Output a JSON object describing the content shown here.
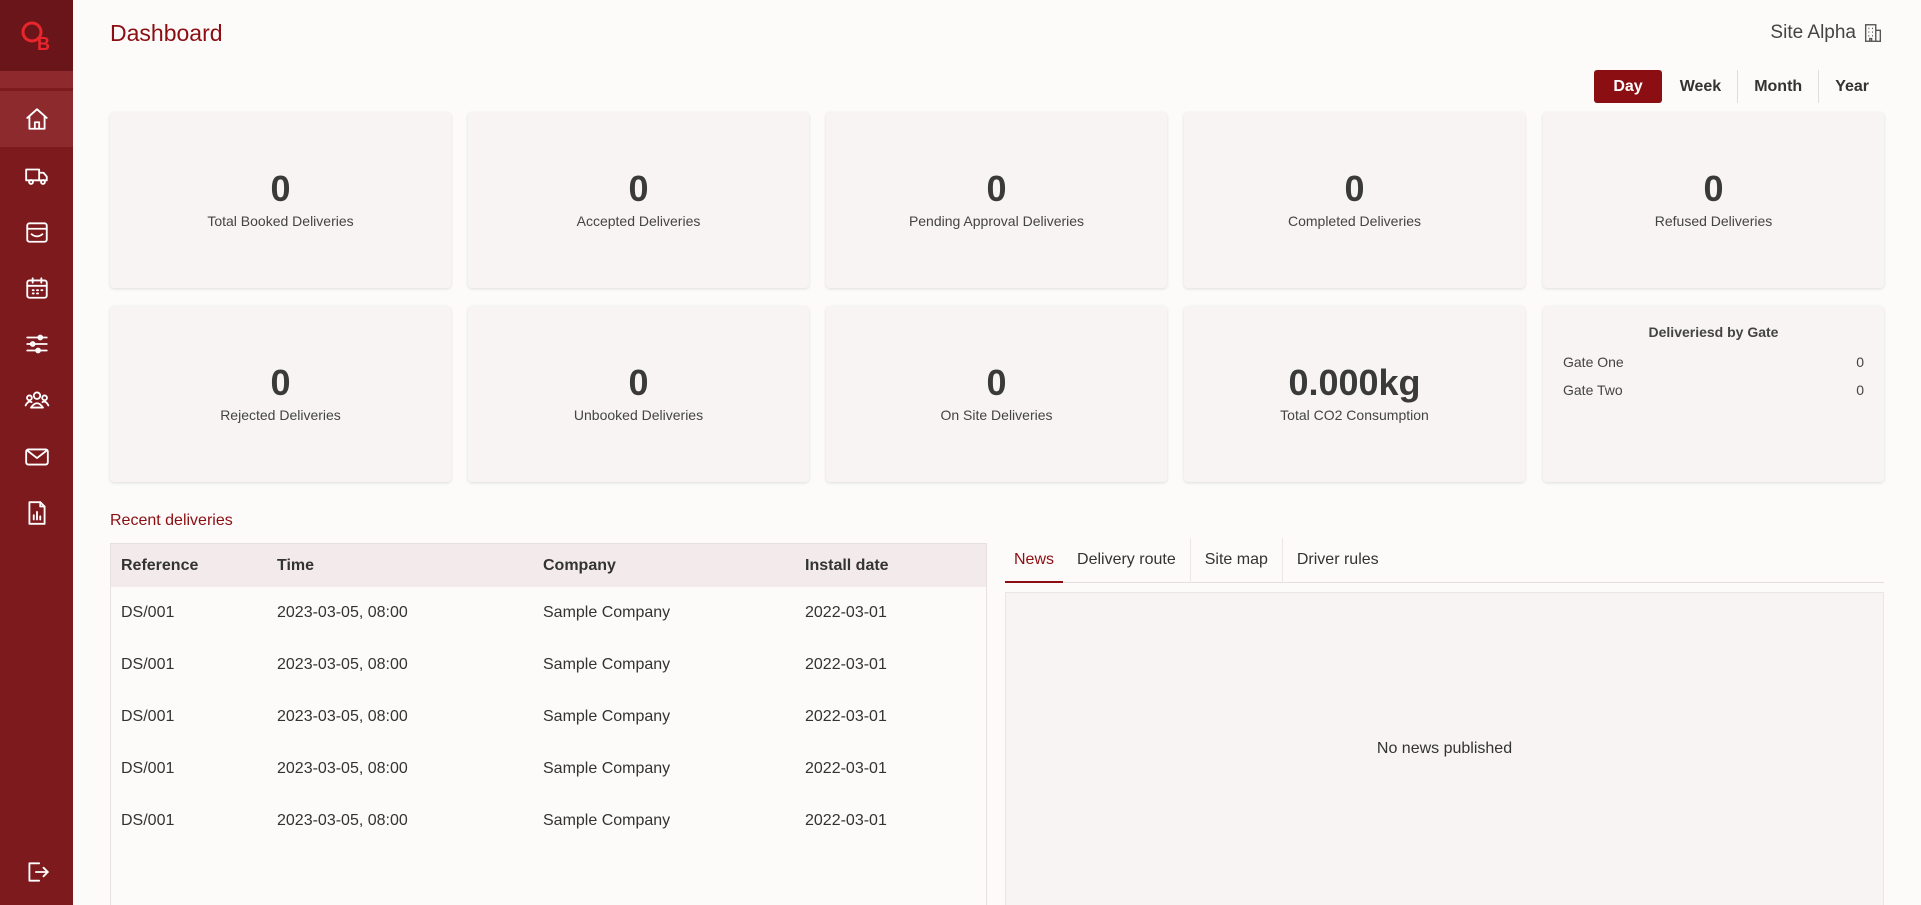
{
  "app": {
    "logo_text": "OB"
  },
  "header": {
    "title": "Dashboard",
    "site": "Site Alpha"
  },
  "nav": [
    {
      "name": "home",
      "icon": "home-icon"
    },
    {
      "name": "deliveries",
      "icon": "truck-icon"
    },
    {
      "name": "inbox",
      "icon": "archive-icon"
    },
    {
      "name": "calendar",
      "icon": "calendar-icon"
    },
    {
      "name": "settings",
      "icon": "sliders-icon"
    },
    {
      "name": "users",
      "icon": "users-icon"
    },
    {
      "name": "messages",
      "icon": "mail-icon"
    },
    {
      "name": "reports",
      "icon": "report-icon"
    },
    {
      "name": "logout",
      "icon": "logout-icon"
    }
  ],
  "period": {
    "options": [
      "Day",
      "Week",
      "Month",
      "Year"
    ],
    "selected": "Day"
  },
  "stats": [
    {
      "value": "0",
      "label": "Total Booked Deliveries"
    },
    {
      "value": "0",
      "label": "Accepted Deliveries"
    },
    {
      "value": "0",
      "label": "Pending Approval Deliveries"
    },
    {
      "value": "0",
      "label": "Completed Deliveries"
    },
    {
      "value": "0",
      "label": "Refused Deliveries"
    },
    {
      "value": "0",
      "label": "Rejected Deliveries"
    },
    {
      "value": "0",
      "label": "Unbooked Deliveries"
    },
    {
      "value": "0",
      "label": "On Site Deliveries"
    },
    {
      "value": "0.000kg",
      "label": "Total CO2 Consumption"
    }
  ],
  "gates": {
    "title": "Deliveriesd by Gate",
    "rows": [
      {
        "name": "Gate One",
        "count": "0"
      },
      {
        "name": "Gate Two",
        "count": "0"
      }
    ]
  },
  "recent": {
    "title": "Recent deliveries",
    "columns": [
      "Reference",
      "Time",
      "Company",
      "Install date"
    ],
    "rows": [
      [
        "DS/001",
        "2023-03-05, 08:00",
        "Sample Company",
        "2022-03-01"
      ],
      [
        "DS/001",
        "2023-03-05, 08:00",
        "Sample Company",
        "2022-03-01"
      ],
      [
        "DS/001",
        "2023-03-05, 08:00",
        "Sample Company",
        "2022-03-01"
      ],
      [
        "DS/001",
        "2023-03-05, 08:00",
        "Sample Company",
        "2022-03-01"
      ],
      [
        "DS/001",
        "2023-03-05, 08:00",
        "Sample Company",
        "2022-03-01"
      ]
    ]
  },
  "tabs": {
    "items": [
      "News",
      "Delivery route",
      "Site map",
      "Driver rules"
    ],
    "selected": "News"
  },
  "news": {
    "empty": "No news published"
  },
  "colors": {
    "brand": "#8b0e12",
    "sidebar": "#7d1a1e"
  }
}
